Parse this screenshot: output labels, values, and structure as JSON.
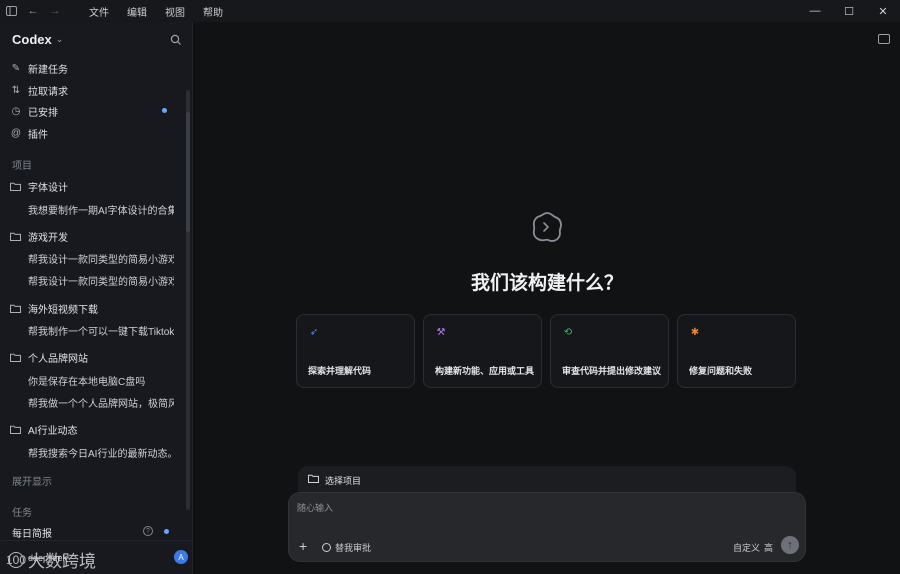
{
  "titlebar": {
    "menu": [
      "文件",
      "编辑",
      "视图",
      "帮助"
    ]
  },
  "sidebar": {
    "brand": "Codex",
    "nav": [
      {
        "label": "新建任务",
        "icon": "edit-icon"
      },
      {
        "label": "拉取请求",
        "icon": "pull-request-icon"
      },
      {
        "label": "已安排",
        "icon": "clock-icon"
      },
      {
        "label": "插件",
        "icon": "at-icon"
      }
    ],
    "projects_label": "项目",
    "projects": [
      {
        "name": "字体设计",
        "threads": [
          "我想要制作一期AI字体设计的合集"
        ]
      },
      {
        "name": "游戏开发",
        "threads": [
          "帮我设计一款同类型的简易小游戏",
          "帮我设计一款同类型的简易小游戏"
        ]
      },
      {
        "name": "海外短视频下载",
        "threads": [
          "帮我制作一个可以一键下载Tiktok"
        ]
      },
      {
        "name": "个人品牌网站",
        "threads": [
          "你是保存在本地电脑C盘吗",
          "帮我做一个个人品牌网站，极简风"
        ]
      },
      {
        "name": "AI行业动态",
        "threads": [
          "帮我搜索今日AI行业的最新动态。"
        ]
      }
    ],
    "expand_label": "展开显示",
    "tasks_label": "任务",
    "tasks": [
      {
        "label": "每日简报"
      }
    ],
    "footer_user": "deepseek",
    "footer_avatar": "A",
    "watermark": "大数跨境",
    "watermark_logo": "100"
  },
  "main": {
    "hero_title": "我们该构建什么？",
    "cards": [
      {
        "label": "探索并理解代码",
        "icon": "rocket-icon",
        "color": "#4c8df6",
        "glyph": "➶"
      },
      {
        "label": "构建新功能、应用或工具",
        "icon": "hammer-icon",
        "color": "#b07cf0",
        "glyph": "⚒"
      },
      {
        "label": "审查代码并提出修改建议",
        "icon": "review-icon",
        "color": "#3fb96b",
        "glyph": "⟲"
      },
      {
        "label": "修复问题和失败",
        "icon": "bug-icon",
        "color": "#e8843a",
        "glyph": "✱"
      }
    ],
    "project_chip": "选择项目",
    "composer": {
      "placeholder": "随心输入",
      "approval_label": "替我审批",
      "custom_label": "自定义",
      "custom_suffix": "高"
    }
  }
}
